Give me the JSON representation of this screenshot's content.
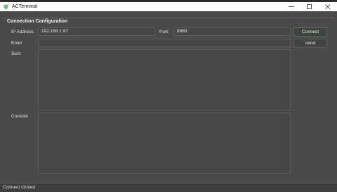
{
  "window": {
    "title": "ACTerminal",
    "controls": {
      "minimize": "minimize-icon",
      "maximize": "maximize-icon",
      "close": "close-icon"
    }
  },
  "connection": {
    "group_title": "Connection Configuration",
    "ip_label": "IP Address:",
    "ip_value": "192.168.1.67",
    "port_label": "Port:",
    "port_value": "8888",
    "connect_label": "Connect"
  },
  "enter": {
    "label": "Enter",
    "value": "",
    "send_label": "send"
  },
  "sent": {
    "label": "Sent",
    "content": ""
  },
  "console": {
    "label": "Console",
    "content": ""
  },
  "status": {
    "text": "Connect clicked"
  },
  "colors": {
    "background": "#4a4a4a",
    "titlebar": "#ffffff",
    "field": "#474747",
    "connect_button": "#3f463f"
  }
}
